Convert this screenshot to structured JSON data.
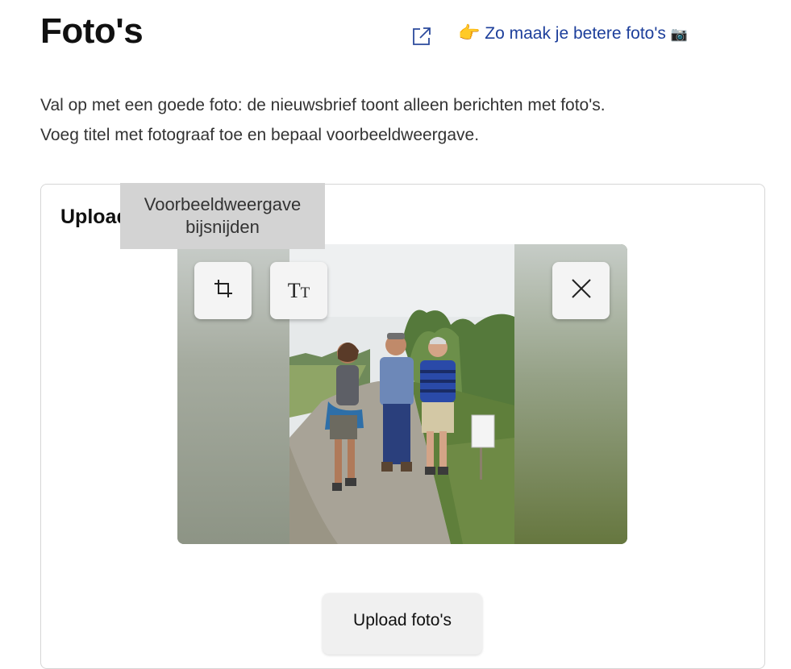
{
  "header": {
    "title": "Foto's",
    "external_link_icon": "external-link-icon",
    "tips_emoji": "👉",
    "tips_label": "Zo maak je betere foto's",
    "tips_camera_emoji": "📷"
  },
  "intro": {
    "line1": "Val op met een goede foto: de nieuwsbrief toont alleen berichten met foto's.",
    "line2": "Voeg titel met fotograaf toe en bepaal voorbeeldweergave."
  },
  "card": {
    "heading": "Upload"
  },
  "tooltip": {
    "line1": "Voorbeeldweergave",
    "line2": "bijsnijden"
  },
  "preview": {
    "crop_icon": "crop-icon",
    "text_icon": "text-size-icon",
    "close_icon": "close-icon",
    "text_glyph_big": "T",
    "text_glyph_small": "T",
    "photo": {
      "alt": "Photo of three hikers standing on a country path"
    }
  },
  "upload_button": {
    "label": "Upload foto's"
  },
  "colors": {
    "link": "#1d3f9b",
    "tooltip_bg": "#d3d3d3",
    "button_bg": "#f0f0f0"
  }
}
